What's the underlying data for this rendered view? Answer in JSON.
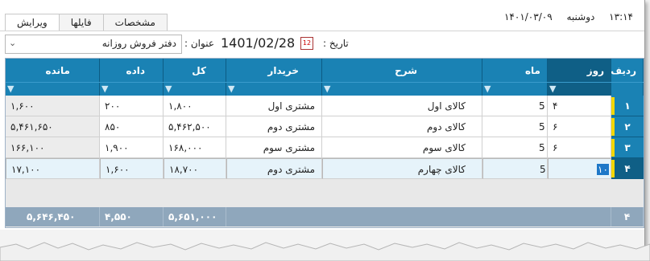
{
  "tabs": [
    "ویرایش",
    "فایلها",
    "مشخصات"
  ],
  "datetime": {
    "time": "۱۳:۱۴",
    "weekday": "دوشنبه",
    "date": "۱۴۰۱/۰۳/۰۹"
  },
  "form": {
    "date_label": "تاریخ :",
    "date_value": "1401/02/28",
    "title_label": "عنوان :",
    "title_value": "دفتر فروش روزانه"
  },
  "grid": {
    "columns": [
      "ردیف",
      "روز",
      "ماه",
      "شرح",
      "خریدار",
      "کل",
      "داده",
      "مانده"
    ],
    "rows": [
      {
        "rownum": "۱",
        "day": "۴",
        "month": "5",
        "desc": "کالای اول",
        "buyer": "مشتری اول",
        "total": "۱,۸۰۰",
        "paid": "۲۰۰",
        "remain": "۱,۶۰۰"
      },
      {
        "rownum": "۲",
        "day": "۶",
        "month": "5",
        "desc": "کالای دوم",
        "buyer": "مشتری دوم",
        "total": "۵,۴۶۲,۵۰۰",
        "paid": "۸۵۰",
        "remain": "۵,۴۶۱,۶۵۰"
      },
      {
        "rownum": "۳",
        "day": "۶",
        "month": "5",
        "desc": "کالای سوم",
        "buyer": "مشتری سوم",
        "total": "۱۶۸,۰۰۰",
        "paid": "۱,۹۰۰",
        "remain": "۱۶۶,۱۰۰"
      },
      {
        "rownum": "۴",
        "day": "۱۰",
        "month": "5",
        "desc": "کالای چهارم",
        "buyer": "مشتری دوم",
        "total": "۱۸,۷۰۰",
        "paid": "۱,۶۰۰",
        "remain": "۱۷,۱۰۰"
      }
    ],
    "footer": {
      "count": "۴",
      "total": "۵,۶۵۱,۰۰۰",
      "paid": "۴,۵۵۰",
      "remain": "۵,۶۴۶,۴۵۰"
    }
  },
  "colors": {
    "header": "#1a82b4",
    "header_active": "#0f5f86",
    "footer": "#8fa7bc",
    "marker": "#f3d600"
  }
}
